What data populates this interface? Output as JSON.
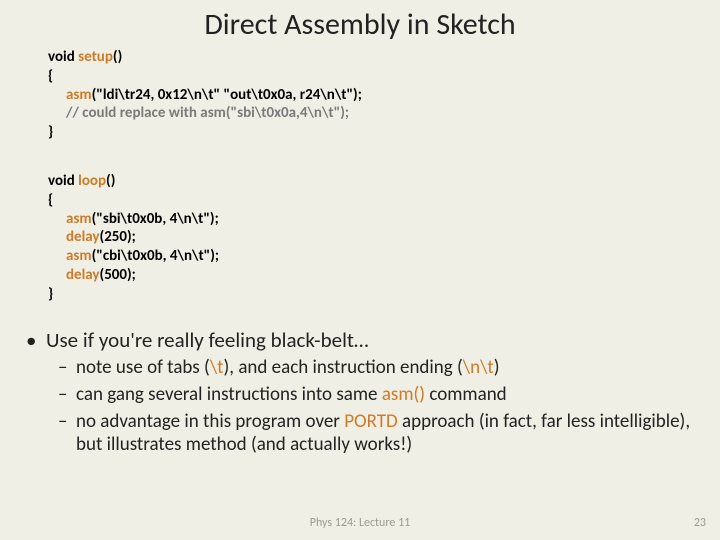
{
  "title": "Direct Assembly in Sketch",
  "code": {
    "setup": {
      "sig_pre": "void ",
      "fn": "setup",
      "sig_post": "()",
      "open": "{",
      "line1_pre": "asm",
      "line1_body": "(\"ldi\\tr24, 0x12\\n\\t\" \"out\\t0x0a, r24\\n\\t\");",
      "line2": "// could replace with asm(\"sbi\\t0x0a,4\\n\\t\");",
      "close": "}"
    },
    "loop": {
      "sig_pre": "void ",
      "fn": "loop",
      "sig_post": "()",
      "open": "{",
      "l1_pre": "asm",
      "l1_body": "(\"sbi\\t0x0b, 4\\n\\t\");",
      "l2_pre": "delay",
      "l2_body": "(250);",
      "l3_pre": "asm",
      "l3_body": "(\"cbi\\t0x0b, 4\\n\\t\");",
      "l4_pre": "delay",
      "l4_body": "(500);",
      "close": "}"
    }
  },
  "bullets": {
    "b1": "Use if you're really feeling black-belt…",
    "s1a": "note use of tabs (",
    "s1b": "\\t",
    "s1c": "), and each instruction ending (",
    "s1d": "\\n\\t",
    "s1e": ")",
    "s2a": "can gang several instructions into same ",
    "s2b": "asm()",
    "s2c": " command",
    "s3a": "no advantage in this program over ",
    "s3b": "PORTD",
    "s3c": " approach (in fact, far less intelligible), but illustrates method (and actually works!)"
  },
  "footer": "Phys 124: Lecture 11",
  "pagenum": "23"
}
